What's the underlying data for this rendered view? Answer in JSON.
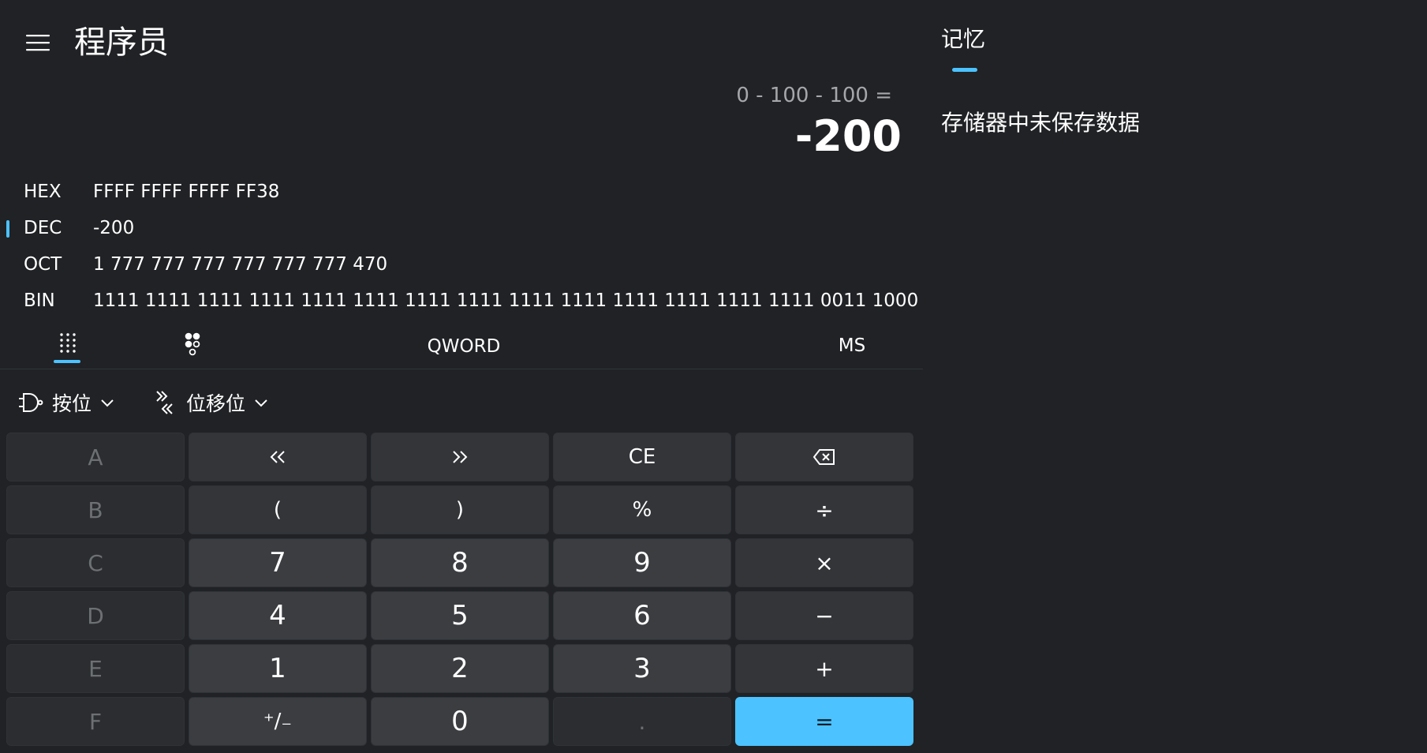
{
  "header": {
    "title": "程序员"
  },
  "display": {
    "expression": "0 - 100 - 100 =",
    "result": "-200"
  },
  "radix": [
    {
      "label": "HEX",
      "value": "FFFF FFFF FFFF FF38",
      "selected": false
    },
    {
      "label": "DEC",
      "value": "-200",
      "selected": true
    },
    {
      "label": "OCT",
      "value": "1 777 777 777 777 777 777 470",
      "selected": false
    },
    {
      "label": "BIN",
      "value": "1111 1111 1111 1111 1111 1111 1111 1111 1111 1111 1111 1111 1111 1111 0011 1000",
      "selected": false
    }
  ],
  "modebar": {
    "word_size": "QWORD",
    "ms_label": "MS",
    "tabs": [
      "full-keypad-icon",
      "bit-toggle-keypad-icon"
    ]
  },
  "operators": {
    "bitwise_label": "按位",
    "shift_label": "位移位"
  },
  "keypad": {
    "A": "A",
    "lsh": "«",
    "rsh": "»",
    "ce": "CE",
    "back_icon": "backspace-icon",
    "B": "B",
    "lparen": "(",
    "rparen": ")",
    "percent": "%",
    "divide": "÷",
    "C": "C",
    "n7": "7",
    "n8": "8",
    "n9": "9",
    "multiply": "×",
    "D": "D",
    "n4": "4",
    "n5": "5",
    "n6": "6",
    "minus": "−",
    "E": "E",
    "n1": "1",
    "n2": "2",
    "n3": "3",
    "plus": "+",
    "F": "F",
    "negate": "⁺∕₋",
    "n0": "0",
    "dot": ".",
    "equals": "="
  },
  "memory": {
    "tab_label": "记忆",
    "empty_message": "存储器中未保存数据"
  },
  "colors": {
    "background": "#202225",
    "accent": "#4cc2ff",
    "key_number": "#3b3d41",
    "key_function": "#333539",
    "key_disabled": "#2b2d30"
  }
}
